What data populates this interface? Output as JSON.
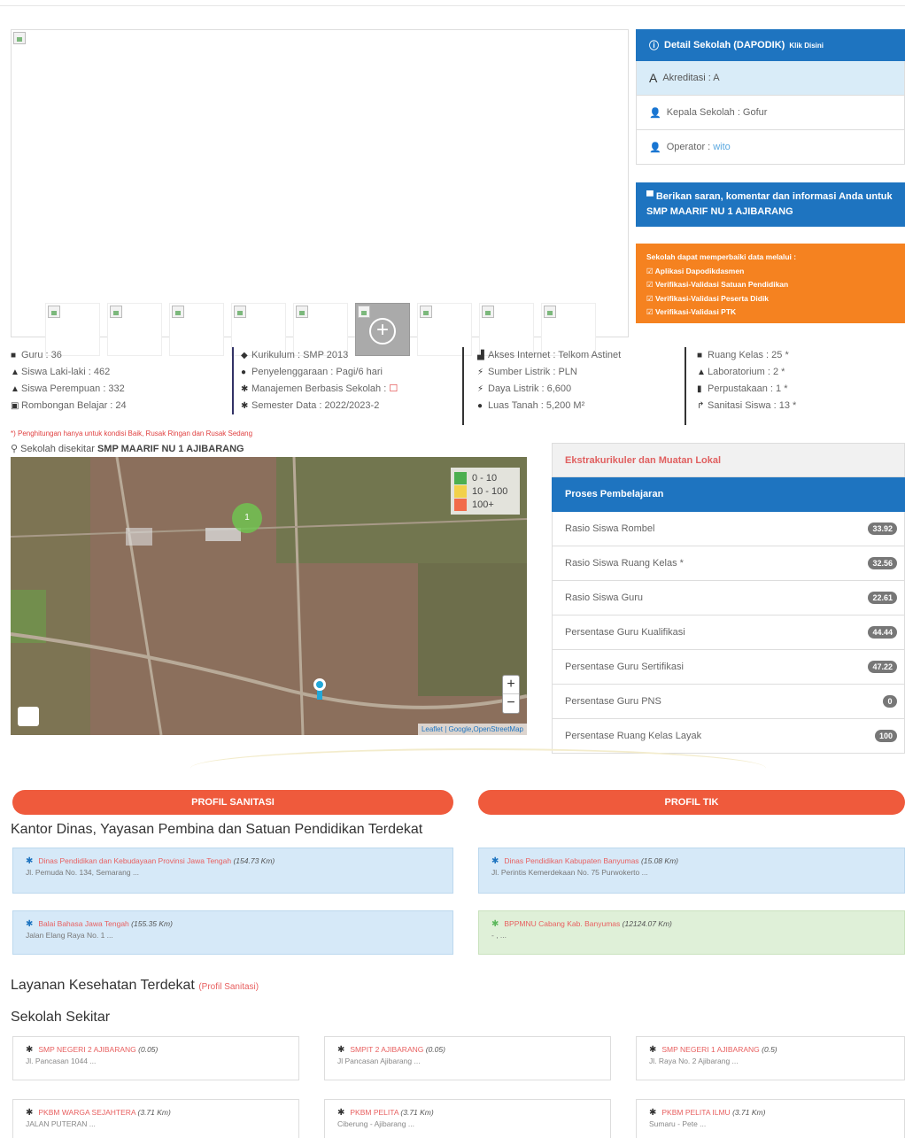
{
  "school_detail": {
    "header": "Detail Sekolah (DAPODIK)",
    "header_link": "Klik Disini",
    "akreditasi": "Akreditasi : A",
    "kepala": "Kepala Sekolah : Gofur",
    "operator_label": "Operator : ",
    "operator_name": "wito"
  },
  "feedback": {
    "text": "Berikan saran, komentar dan informasi Anda untuk ",
    "school": "SMP MAARIF NU 1 AJIBARANG"
  },
  "update_info": {
    "title": "Sekolah dapat memperbaiki data melalui :",
    "items": [
      "Aplikasi Dapodikdasmen",
      "Verifikasi-Validasi Satuan Pendidikan",
      "Verifikasi-Validasi Peserta Didik",
      "Verifikasi-Validasi PTK"
    ]
  },
  "stats": {
    "col1": [
      "Guru : 36",
      "Siswa Laki-laki : 462",
      "Siswa Perempuan : 332",
      "Rombongan Belajar : 24"
    ],
    "col2": [
      "Kurikulum : SMP 2013",
      "Penyelenggaraan : Pagi/6 hari",
      "Manajemen Berbasis Sekolah : ",
      "Semester Data : 2022/2023-2"
    ],
    "col3": [
      "Akses Internet : Telkom Astinet",
      "Sumber Listrik : PLN",
      "Daya Listrik : 6,600",
      "Luas Tanah : 5,200 M²"
    ],
    "col4": [
      "Ruang Kelas : 25 *",
      "Laboratorium : 2 *",
      "Perpustakaan : 1 *",
      "Sanitasi Siswa : 13 *"
    ]
  },
  "note": "*) Penghitungan hanya untuk kondisi Baik, Rusak Ringan dan Rusak Sedang",
  "nearby_label": "Sekolah disekitar ",
  "nearby_school": "SMP MAARIF NU 1 AJIBARANG",
  "map": {
    "legend": [
      {
        "label": "0 - 10",
        "color": "#4caf50"
      },
      {
        "label": "10 - 100",
        "color": "#f2d14a"
      },
      {
        "label": "100+",
        "color": "#f26b4a"
      }
    ],
    "cluster_count": "1",
    "zoom_in": "+",
    "zoom_out": "−",
    "attribution": "Leaflet | Google,OpenStreetMap"
  },
  "panel": {
    "ekskul": "Ekstrakurikuler dan Muatan Lokal",
    "proses": "Proses Pembelajaran",
    "rows": [
      {
        "label": "Rasio Siswa Rombel",
        "value": "33.92"
      },
      {
        "label": "Rasio Siswa Ruang Kelas *",
        "value": "32.56"
      },
      {
        "label": "Rasio Siswa Guru",
        "value": "22.61"
      },
      {
        "label": "Persentase Guru Kualifikasi",
        "value": "44.44"
      },
      {
        "label": "Persentase Guru Sertifikasi",
        "value": "47.22"
      },
      {
        "label": "Persentase Guru PNS",
        "value": "0"
      },
      {
        "label": "Persentase Ruang Kelas Layak",
        "value": "100"
      }
    ]
  },
  "buttons": {
    "sanitasi": "PROFIL SANITASI",
    "tik": "PROFIL TIK"
  },
  "kantor": {
    "title": "Kantor Dinas, Yayasan Pembina dan Satuan Pendidikan Terdekat",
    "cards": [
      {
        "name": "Dinas Pendidikan dan Kebudayaan Provinsi Jawa Tengah",
        "dist": "(154.73 Km)",
        "addr": "Jl. Pemuda No. 134, Semarang ..."
      },
      {
        "name": "Dinas Pendidikan Kabupaten Banyumas",
        "dist": "(15.08 Km)",
        "addr": "Jl. Perintis Kemerdekaan No. 75 Purwokerto ..."
      },
      {
        "name": "Balai Bahasa Jawa Tengah",
        "dist": "(155.35 Km)",
        "addr": "Jalan Elang Raya No. 1 ..."
      },
      {
        "name": "BPPMNU Cabang Kab. Banyumas",
        "dist": "(12124.07 Km)",
        "addr": "- , ..."
      }
    ]
  },
  "kesehatan": {
    "title": "Layanan Kesehatan Terdekat ",
    "link": "(Profil Sanitasi)"
  },
  "sekitar": {
    "title": "Sekolah Sekitar",
    "cards": [
      {
        "name": "SMP NEGERI 2 AJIBARANG",
        "dist": "(0.05)",
        "addr": "Jl. Pancasan 1044 ..."
      },
      {
        "name": "SMPIT 2 AJIBARANG",
        "dist": "(0.05)",
        "addr": "Jl Pancasan Ajibarang ..."
      },
      {
        "name": "SMP NEGERI 1 AJIBARANG",
        "dist": "(0.5)",
        "addr": "Jl. Raya No. 2 Ajibarang ..."
      },
      {
        "name": "PKBM WARGA SEJAHTERA",
        "dist": "(3.71 Km)",
        "addr": "JALAN PUTERAN ..."
      },
      {
        "name": "PKBM PELITA",
        "dist": "(3.71 Km)",
        "addr": "Ciberung - Ajibarang ..."
      },
      {
        "name": "PKBM PELITA ILMU",
        "dist": "(3.71 Km)",
        "addr": "Sumaru - Pete ..."
      }
    ]
  }
}
